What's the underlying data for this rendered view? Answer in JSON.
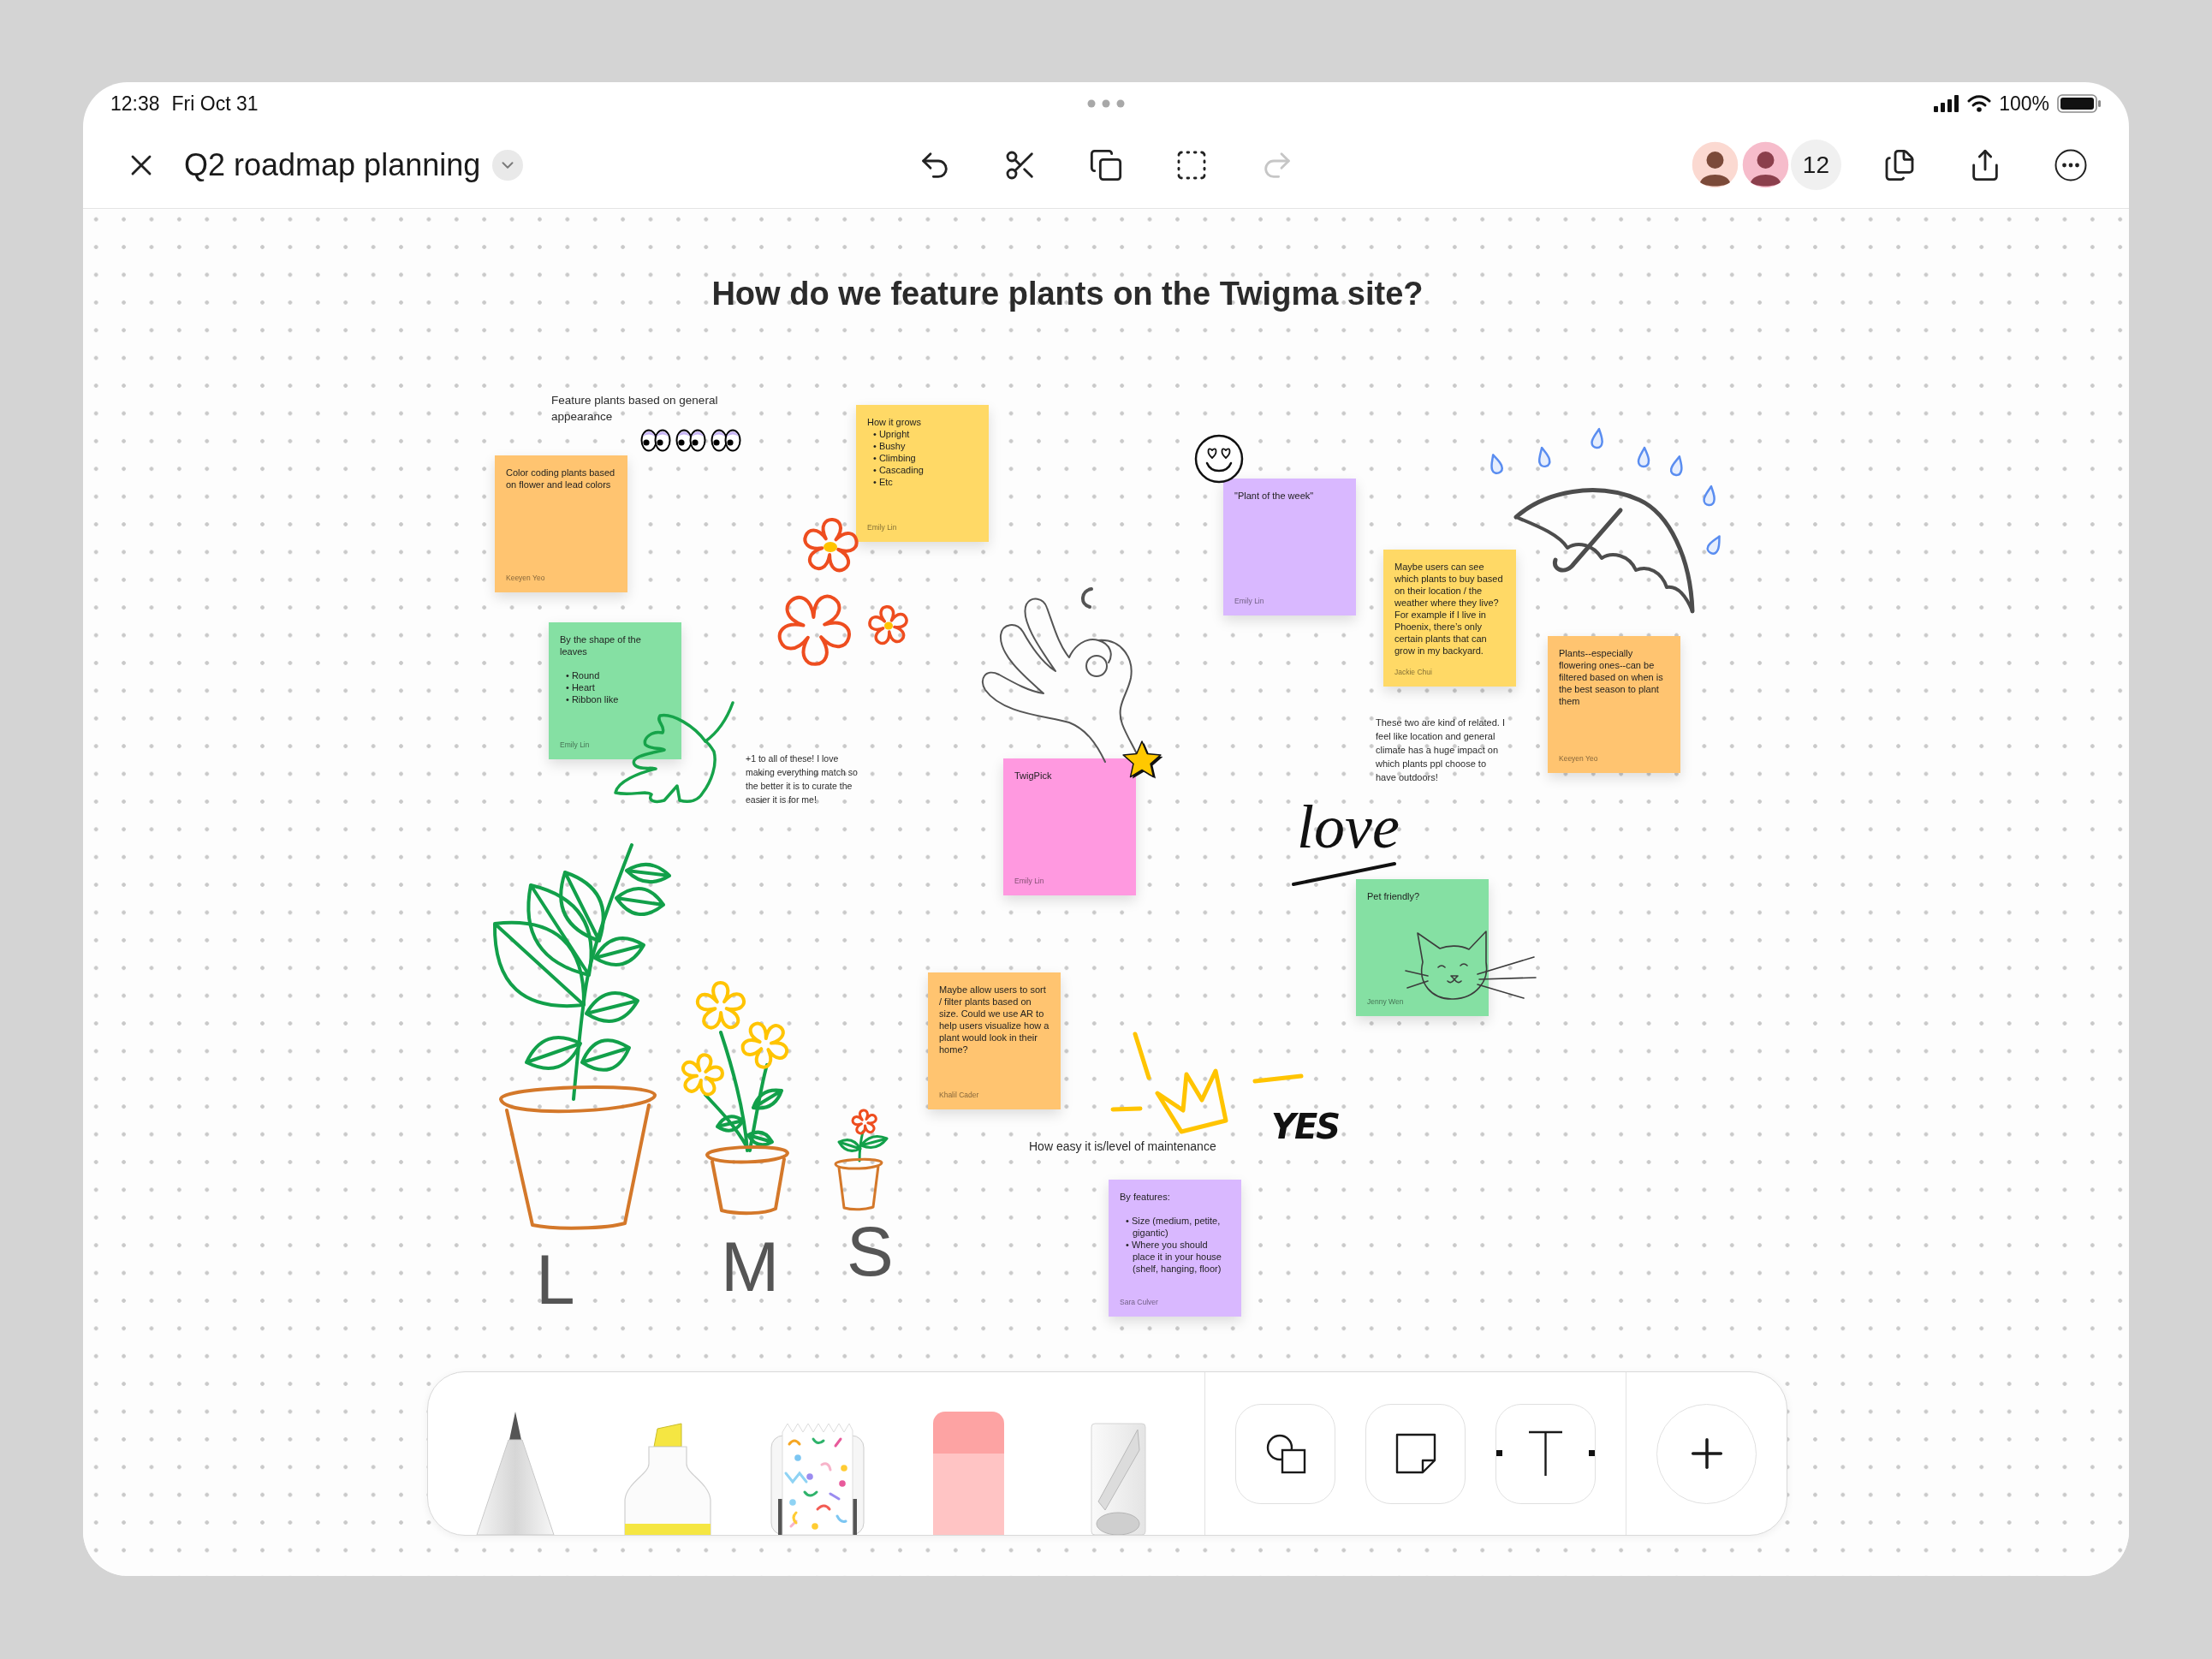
{
  "status_bar": {
    "time": "12:38",
    "date": "Fri Oct 31",
    "battery": "100%"
  },
  "toolbar": {
    "title": "Q2 roadmap planning",
    "actions": [
      {
        "kind": "undo",
        "disabled": false
      },
      {
        "kind": "cut",
        "disabled": false
      },
      {
        "kind": "duplicate",
        "disabled": false
      },
      {
        "kind": "select",
        "disabled": false
      },
      {
        "kind": "redo",
        "disabled": true
      }
    ],
    "collaborator_count": "12"
  },
  "board": {
    "title": "How do we feature plants on the Twigma site?",
    "labels": [
      "Feature plants based on general appearance",
      "+1 to all of these! I love making everything match so the better it is to curate the easier it is for me!",
      "These two are kind of related. I feel like location and general climate has a huge impact on which plants ppl choose to have outdoors!",
      "How easy it is/level of maintenance"
    ],
    "notes": [
      {
        "text": "How it grows",
        "bullets": [
          "• Upright",
          "• Bushy",
          "• Climbing",
          "• Cascading",
          "• Etc"
        ],
        "author": "Emily Lin",
        "color": "#ffd966"
      },
      {
        "text": "Color coding plants based on flower and lead colors",
        "author": "Keeyen Yeo",
        "color": "#ffc470"
      },
      {
        "text": "\"Plant of the week\"",
        "author": "Emily Lin",
        "color": "#d9b8ff"
      },
      {
        "text": "By the shape of the leaves",
        "bullets": [
          "• Round",
          "• Heart",
          "• Ribbon like"
        ],
        "author": "Emily Lin",
        "color": "#85e0a3"
      },
      {
        "text": "Maybe users can see which plants to buy based on their location / the weather where they live? For example if I live in Phoenix, there’s only certain plants that can grow in my backyard.",
        "author": "Jackie Chui",
        "color": "#ffd966"
      },
      {
        "text": "Plants--especially flowering ones--can be filtered based on when is the best season to plant them",
        "author": "Keeyen Yeo",
        "color": "#ffc470"
      },
      {
        "text": "TwigPick",
        "author": "Emily Lin",
        "color": "#ff99e0"
      },
      {
        "text": "Pet friendly?",
        "author": "Jenny Wen",
        "color": "#85e0a3"
      },
      {
        "text": "Maybe allow users to sort / filter plants based on size. Could we use AR to help users visualize how a plant would look in their home?",
        "author": "Khalil Cader",
        "color": "#ffc470"
      },
      {
        "text": "By features:",
        "bullets": [
          "• Size (medium, petite, gigantic)",
          "• Where you should place it in your house (shelf, hanging, floor)"
        ],
        "author": "Sara Culver",
        "color": "#d9b8ff"
      }
    ],
    "handwriting": [
      {
        "kind": "script",
        "text": "love"
      },
      {
        "kind": "block",
        "text": "YES"
      },
      {
        "kind": "letter",
        "text": "L"
      },
      {
        "kind": "letter",
        "text": "M"
      },
      {
        "kind": "letter",
        "text": "S"
      }
    ]
  }
}
